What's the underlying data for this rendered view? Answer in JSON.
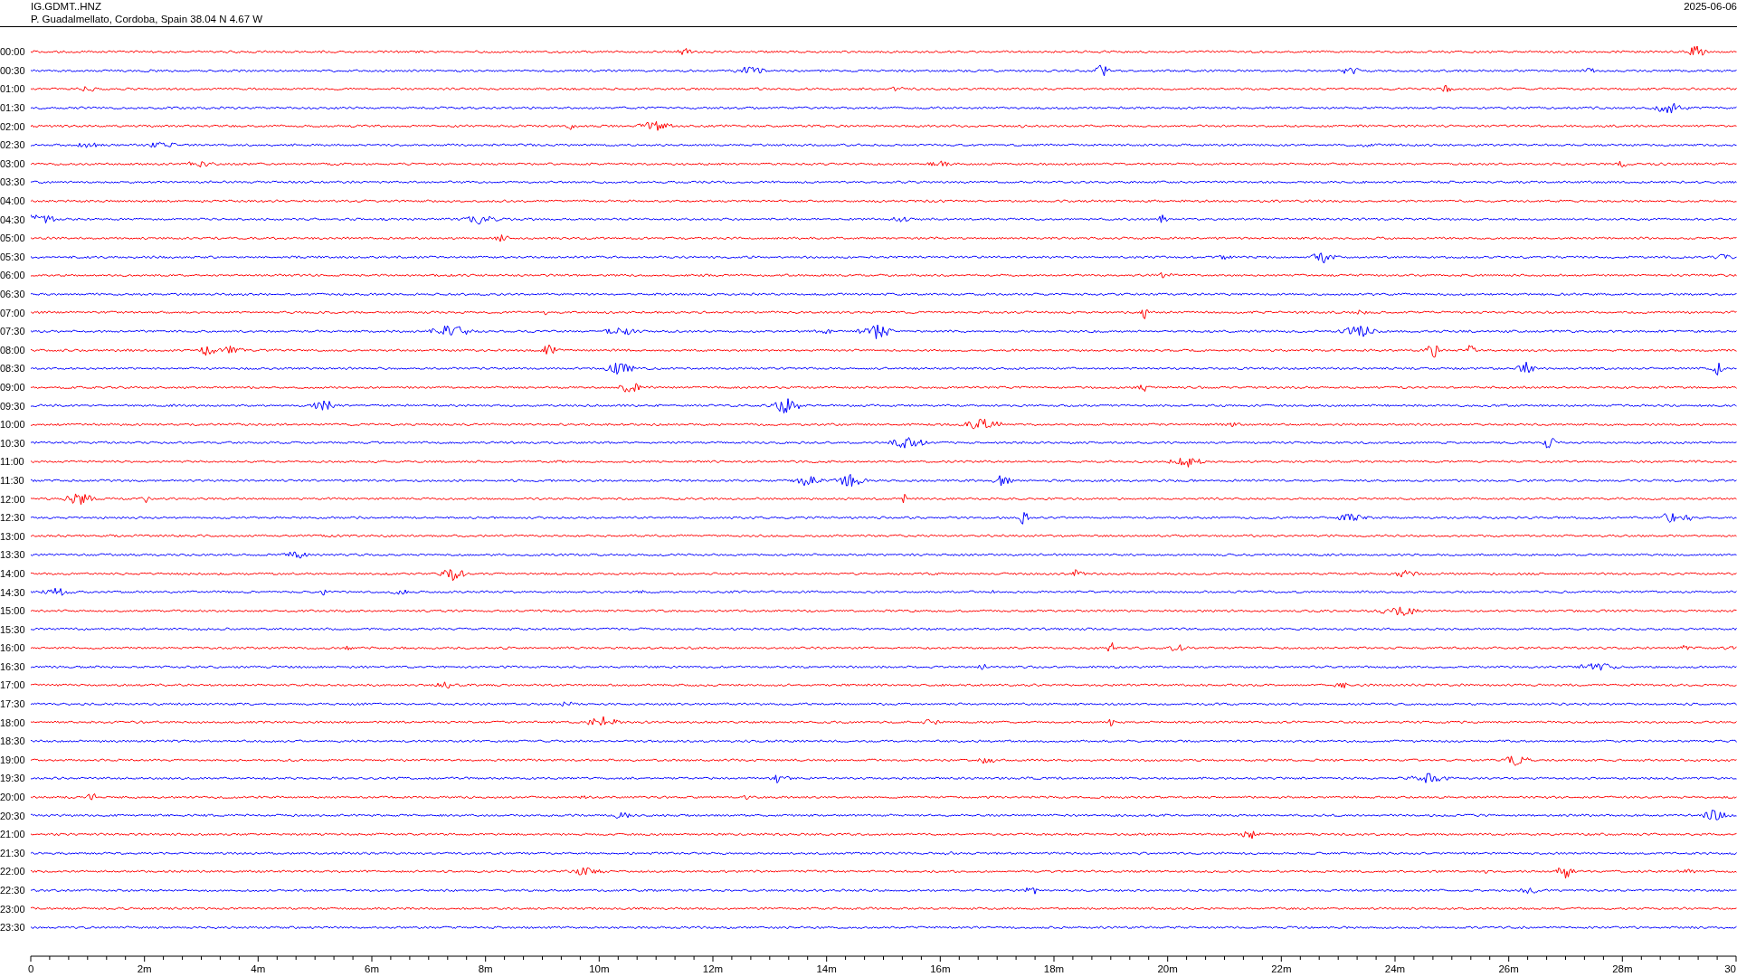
{
  "header": {
    "channel": "IG.GDMT..HNZ",
    "station": "P. Guadalmellato, Cordoba, Spain  38.04 N 4.67 W",
    "date": "2025-06-06"
  },
  "rows": [
    {
      "label": "00:00",
      "color": "#ff0000"
    },
    {
      "label": "00:30",
      "color": "#0000ff"
    },
    {
      "label": "01:00",
      "color": "#ff0000"
    },
    {
      "label": "01:30",
      "color": "#0000ff"
    },
    {
      "label": "02:00",
      "color": "#ff0000"
    },
    {
      "label": "02:30",
      "color": "#0000ff"
    },
    {
      "label": "03:00",
      "color": "#ff0000"
    },
    {
      "label": "03:30",
      "color": "#0000ff"
    },
    {
      "label": "04:00",
      "color": "#ff0000"
    },
    {
      "label": "04:30",
      "color": "#0000ff"
    },
    {
      "label": "05:00",
      "color": "#ff0000"
    },
    {
      "label": "05:30",
      "color": "#0000ff"
    },
    {
      "label": "06:00",
      "color": "#ff0000"
    },
    {
      "label": "06:30",
      "color": "#0000ff"
    },
    {
      "label": "07:00",
      "color": "#ff0000"
    },
    {
      "label": "07:30",
      "color": "#0000ff"
    },
    {
      "label": "08:00",
      "color": "#ff0000"
    },
    {
      "label": "08:30",
      "color": "#0000ff"
    },
    {
      "label": "09:00",
      "color": "#ff0000"
    },
    {
      "label": "09:30",
      "color": "#0000ff"
    },
    {
      "label": "10:00",
      "color": "#ff0000"
    },
    {
      "label": "10:30",
      "color": "#0000ff"
    },
    {
      "label": "11:00",
      "color": "#ff0000"
    },
    {
      "label": "11:30",
      "color": "#0000ff"
    },
    {
      "label": "12:00",
      "color": "#ff0000"
    },
    {
      "label": "12:30",
      "color": "#0000ff"
    },
    {
      "label": "13:00",
      "color": "#ff0000"
    },
    {
      "label": "13:30",
      "color": "#0000ff"
    },
    {
      "label": "14:00",
      "color": "#ff0000"
    },
    {
      "label": "14:30",
      "color": "#0000ff"
    },
    {
      "label": "15:00",
      "color": "#ff0000"
    },
    {
      "label": "15:30",
      "color": "#0000ff"
    },
    {
      "label": "16:00",
      "color": "#ff0000"
    },
    {
      "label": "16:30",
      "color": "#0000ff"
    },
    {
      "label": "17:00",
      "color": "#ff0000"
    },
    {
      "label": "17:30",
      "color": "#0000ff"
    },
    {
      "label": "18:00",
      "color": "#ff0000"
    },
    {
      "label": "18:30",
      "color": "#0000ff"
    },
    {
      "label": "19:00",
      "color": "#ff0000"
    },
    {
      "label": "19:30",
      "color": "#0000ff"
    },
    {
      "label": "20:00",
      "color": "#ff0000"
    },
    {
      "label": "20:30",
      "color": "#0000ff"
    },
    {
      "label": "21:00",
      "color": "#ff0000"
    },
    {
      "label": "21:30",
      "color": "#0000ff"
    },
    {
      "label": "22:00",
      "color": "#ff0000"
    },
    {
      "label": "22:30",
      "color": "#0000ff"
    },
    {
      "label": "23:00",
      "color": "#ff0000"
    },
    {
      "label": "23:30",
      "color": "#0000ff"
    }
  ],
  "axis": {
    "ticks": [
      "0",
      "2m",
      "4m",
      "6m",
      "8m",
      "10m",
      "12m",
      "14m",
      "16m",
      "18m",
      "20m",
      "22m",
      "24m",
      "26m",
      "28m",
      "30"
    ]
  }
}
